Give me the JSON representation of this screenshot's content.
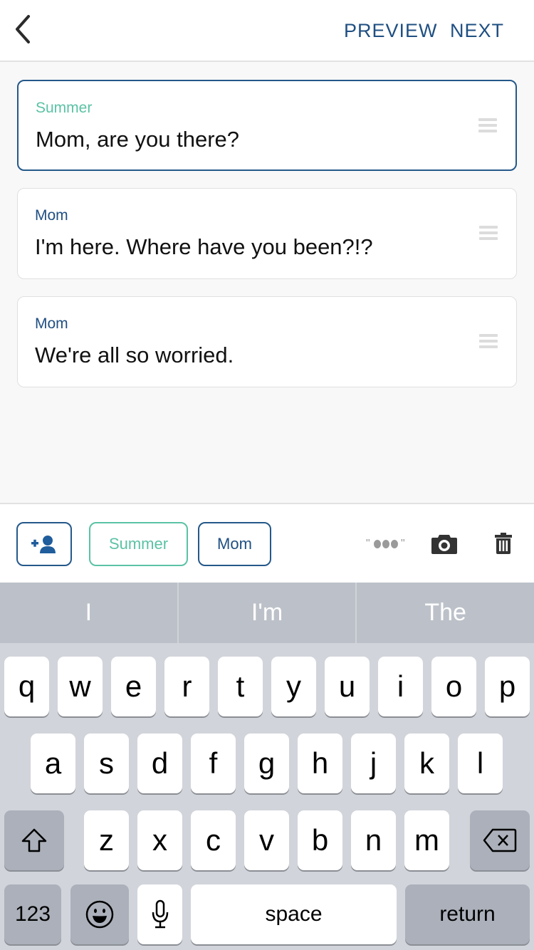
{
  "header": {
    "back_icon": "chevron-left-icon",
    "preview_label": "PREVIEW",
    "next_label": "NEXT"
  },
  "messages": [
    {
      "speaker": "Summer",
      "text": "Mom, are you there?",
      "active": true
    },
    {
      "speaker": "Mom",
      "text": "I'm here. Where have you been?!?",
      "active": false
    },
    {
      "speaker": "Mom",
      "text": "We're all so worried.",
      "active": false
    }
  ],
  "toolbar": {
    "add_character_icon": "add-person-icon",
    "characters": [
      "Summer",
      "Mom"
    ],
    "typing_icon": "typing-indicator-icon",
    "camera_icon": "camera-icon",
    "delete_icon": "trash-icon"
  },
  "colors": {
    "primary": "#1f4f82",
    "summer": "#5bc2a5",
    "border": "#24588a"
  },
  "keyboard": {
    "suggestions": [
      "I",
      "I'm",
      "The"
    ],
    "row1": [
      "q",
      "w",
      "e",
      "r",
      "t",
      "y",
      "u",
      "i",
      "o",
      "p"
    ],
    "row2": [
      "a",
      "s",
      "d",
      "f",
      "g",
      "h",
      "j",
      "k",
      "l"
    ],
    "row3": [
      "z",
      "x",
      "c",
      "v",
      "b",
      "n",
      "m"
    ],
    "numbers_label": "123",
    "space_label": "space",
    "return_label": "return"
  }
}
